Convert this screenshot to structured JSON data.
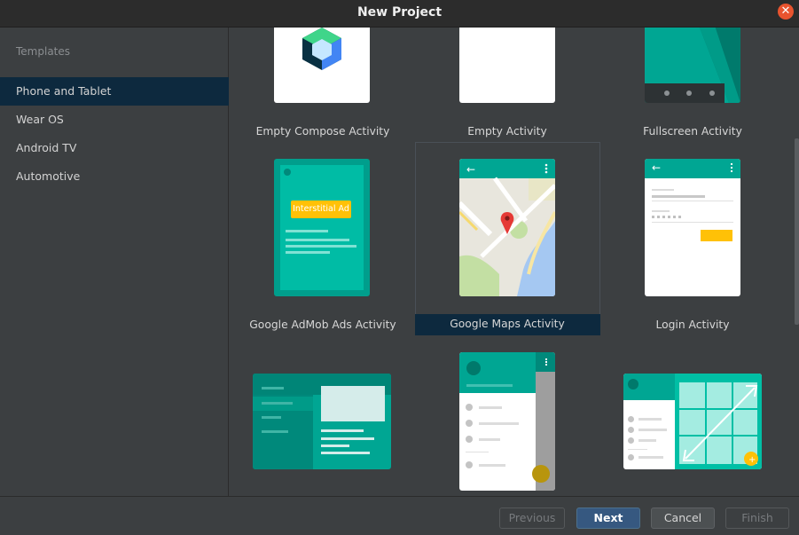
{
  "window": {
    "title": "New Project"
  },
  "sidebar": {
    "header": "Templates",
    "items": [
      {
        "label": "Phone and Tablet",
        "selected": true
      },
      {
        "label": "Wear OS"
      },
      {
        "label": "Android TV"
      },
      {
        "label": "Automotive"
      }
    ]
  },
  "templates": [
    {
      "label": "Empty Compose Activity"
    },
    {
      "label": "Empty Activity"
    },
    {
      "label": "Fullscreen Activity"
    },
    {
      "label": "Google AdMob Ads Activity",
      "preview_badge": "Interstitial Ad"
    },
    {
      "label": "Google Maps Activity",
      "selected": true
    },
    {
      "label": "Login Activity"
    }
  ],
  "footer": {
    "previous": "Previous",
    "next": "Next",
    "cancel": "Cancel",
    "finish": "Finish"
  },
  "colors": {
    "accent_teal": "#00a693",
    "selection": "#0d293e",
    "primary_button": "#365880",
    "close_button": "#e9542f"
  }
}
